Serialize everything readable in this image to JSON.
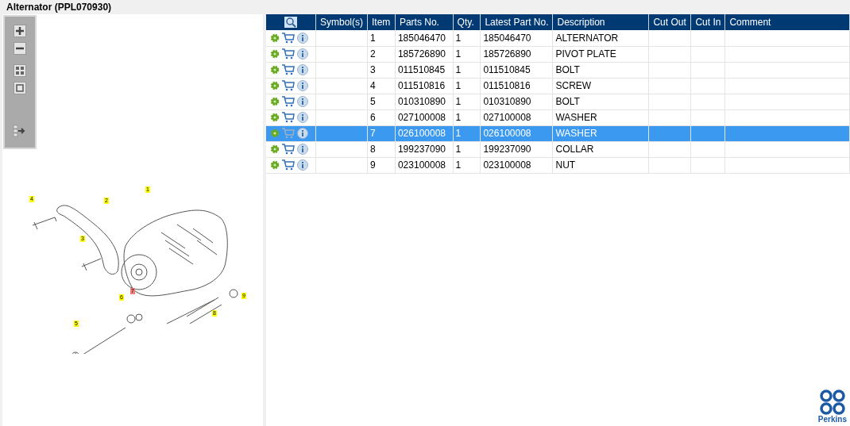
{
  "window": {
    "title": "Alternator (PPL070930)"
  },
  "diagram": {
    "callouts": [
      {
        "label": "1",
        "selected": false
      },
      {
        "label": "2",
        "selected": false
      },
      {
        "label": "3",
        "selected": false
      },
      {
        "label": "4",
        "selected": false
      },
      {
        "label": "5",
        "selected": false
      },
      {
        "label": "6",
        "selected": false
      },
      {
        "label": "7",
        "selected": true
      },
      {
        "label": "8",
        "selected": false
      },
      {
        "label": "9",
        "selected": false
      }
    ]
  },
  "table": {
    "columns": [
      "Symbol(s)",
      "Item",
      "Parts No.",
      "Qty.",
      "Latest Part No.",
      "Description",
      "Cut Out",
      "Cut In",
      "Comment"
    ],
    "rows": [
      {
        "selected": false,
        "cells": [
          "",
          "1",
          "185046470",
          "1",
          "185046470",
          "ALTERNATOR",
          "",
          "",
          ""
        ]
      },
      {
        "selected": false,
        "cells": [
          "",
          "2",
          "185726890",
          "1",
          "185726890",
          "PIVOT PLATE",
          "",
          "",
          ""
        ]
      },
      {
        "selected": false,
        "cells": [
          "",
          "3",
          "011510845",
          "1",
          "011510845",
          "BOLT",
          "",
          "",
          ""
        ]
      },
      {
        "selected": false,
        "cells": [
          "",
          "4",
          "011510816",
          "1",
          "011510816",
          "SCREW",
          "",
          "",
          ""
        ]
      },
      {
        "selected": false,
        "cells": [
          "",
          "5",
          "010310890",
          "1",
          "010310890",
          "BOLT",
          "",
          "",
          ""
        ]
      },
      {
        "selected": false,
        "cells": [
          "",
          "6",
          "027100008",
          "1",
          "027100008",
          "WASHER",
          "",
          "",
          ""
        ]
      },
      {
        "selected": true,
        "cells": [
          "",
          "7",
          "026100008",
          "1",
          "026100008",
          "WASHER",
          "",
          "",
          ""
        ]
      },
      {
        "selected": false,
        "cells": [
          "",
          "8",
          "199237090",
          "1",
          "199237090",
          "COLLAR",
          "",
          "",
          ""
        ]
      },
      {
        "selected": false,
        "cells": [
          "",
          "9",
          "023100008",
          "1",
          "023100008",
          "NUT",
          "",
          "",
          ""
        ]
      }
    ]
  },
  "logo": {
    "text": "Perkins"
  }
}
